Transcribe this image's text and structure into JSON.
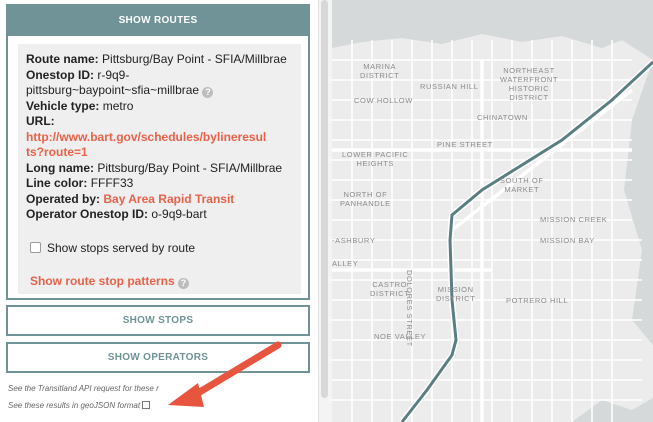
{
  "routes_header": "SHOW ROUTES",
  "route": {
    "route_name_label": "Route name:",
    "route_name": "Pittsburg/Bay Point - SFIA/Millbrae",
    "onestop_label": "Onestop ID:",
    "onestop_line1": "r-9q9-",
    "onestop_line2": "pittsburg~baypoint~sfia~millbrae",
    "vehicle_label": "Vehicle type:",
    "vehicle": "metro",
    "url_label": "URL:",
    "url_line1": "http://www.bart.gov/schedules/bylineresul",
    "url_line2": "ts?route=1",
    "long_name_label": "Long name:",
    "long_name": "Pittsburg/Bay Point - SFIA/Millbrae",
    "line_color_label": "Line color:",
    "line_color": "FFFF33",
    "operated_label": "Operated by:",
    "operated_by": "Bay Area Rapid Transit",
    "operator_id_label": "Operator Onestop ID:",
    "operator_id": "o-9q9-bart",
    "show_stops_checkbox": "Show stops served by route",
    "patterns_link": "Show route stop patterns"
  },
  "buttons": {
    "stops": "SHOW STOPS",
    "operators": "SHOW OPERATORS"
  },
  "footer": {
    "api_text": "See the Transitland API request for these r",
    "geojson_text": "See these results in geoJSON format"
  },
  "map_labels": {
    "marina": "MARINA\nDISTRICT",
    "northeast": "NORTHEAST\nWATERFRONT\nHISTORIC\nDISTRICT",
    "russian_hill": "RUSSIAN HILL",
    "cow_hollow": "COW HOLLOW",
    "chinatown": "CHINATOWN",
    "pine": "PINE STREET",
    "lower_pacific": "LOWER PACIFIC\nHEIGHTS",
    "south_market": "SOUTH OF\nMARKET",
    "north_panhandle": "NORTH OF\nPANHANDLE",
    "mission_creek": "MISSION CREEK",
    "mission_bay": "MISSION BAY",
    "ashbury": "-ASHBURY",
    "alley": "ALLEY",
    "dolores": "DOLORES STREET",
    "castro": "CASTRO\nDISTRICT",
    "mission": "MISSION\nDISTRICT",
    "potrero": "POTRERO HILL",
    "noe": "NOE VALLEY"
  },
  "colors": {
    "accent": "#6f9396",
    "link": "#e8624a",
    "route_line": "#5a7f82",
    "arrow": "#e8553f"
  }
}
